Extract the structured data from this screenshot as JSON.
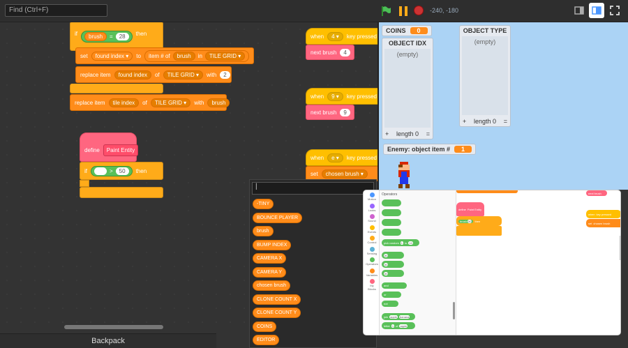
{
  "topbar": {
    "find_placeholder": "Find (Ctrl+F)",
    "coords": "-240, -180"
  },
  "code": {
    "if_label": "if",
    "then_label": "then",
    "var_brush": "brush",
    "eq": "=",
    "num_28": "28",
    "set_label": "set",
    "found_index": "found index",
    "to_label": "to",
    "item_num_of": "item # of",
    "in_label": "in",
    "tile_grid": "TILE GRID",
    "replace_item": "replace item",
    "of_label": "of",
    "with_label": "with",
    "num_2": "2",
    "tile_index": "tile index",
    "define_label": "define",
    "paint_entity": "Paint Entity",
    "gt": ">",
    "num_50": "50",
    "when_label": "when",
    "key_pressed": "key pressed",
    "key_4": "4",
    "key_9": "9",
    "key_e": "e",
    "next_brush": "next brush",
    "chosen_brush": "chosen brush",
    "backpack": "Backpack"
  },
  "stage": {
    "coins_label": "COINS",
    "coins_value": "0",
    "object_idx": "OBJECT IDX",
    "object_type": "OBJECT TYPE",
    "empty": "(empty)",
    "plus": "+",
    "length_label": "length 0",
    "eqsign": "=",
    "enemy_label": "Enemy: object item #",
    "enemy_value": "1"
  },
  "palette": {
    "items": [
      "-TINY",
      "BOUNCE PLAYER",
      "brush",
      "BUMP INDEX",
      "CAMERA X",
      "CAMERA Y",
      "chosen brush",
      "CLONE COUNT X",
      "CLONE COUNT Y",
      "COINS",
      "EDITOR"
    ]
  },
  "preview": {
    "category_title": "Operators",
    "categories": [
      {
        "name": "Motion",
        "color": "#4c97ff"
      },
      {
        "name": "Looks",
        "color": "#9966ff"
      },
      {
        "name": "Sound",
        "color": "#cf63cf"
      },
      {
        "name": "Events",
        "color": "#ffbf00"
      },
      {
        "name": "Control",
        "color": "#ffab19"
      },
      {
        "name": "Sensing",
        "color": "#5cb1d6"
      },
      {
        "name": "Operators",
        "color": "#59c059"
      },
      {
        "name": "Variables",
        "color": "#ff8c1a"
      },
      {
        "name": "My Blocks",
        "color": "#ff6680"
      }
    ],
    "pick_random": "pick random",
    "to": "to",
    "num_1": "1",
    "num_10": "10",
    "num_50": "50",
    "and": "and",
    "or": "or",
    "not": "not",
    "join": "join",
    "apple": "apple",
    "banana": "banana",
    "letter": "letter",
    "of": "of",
    "define": "define",
    "paint_entity": "Paint Entity",
    "brush": "brush",
    "then": "then",
    "next_brush": "next brush",
    "key_pressed": "key pressed",
    "chosen_brush": "chosen brush",
    "when": "when",
    "set": "set"
  },
  "colors": {
    "control": "#ffab19",
    "variables": "#ff8c1a",
    "events": "#ffbf00",
    "myblocks": "#ff6680",
    "operators": "#59c059",
    "stage_bg": "#abd3f5"
  }
}
